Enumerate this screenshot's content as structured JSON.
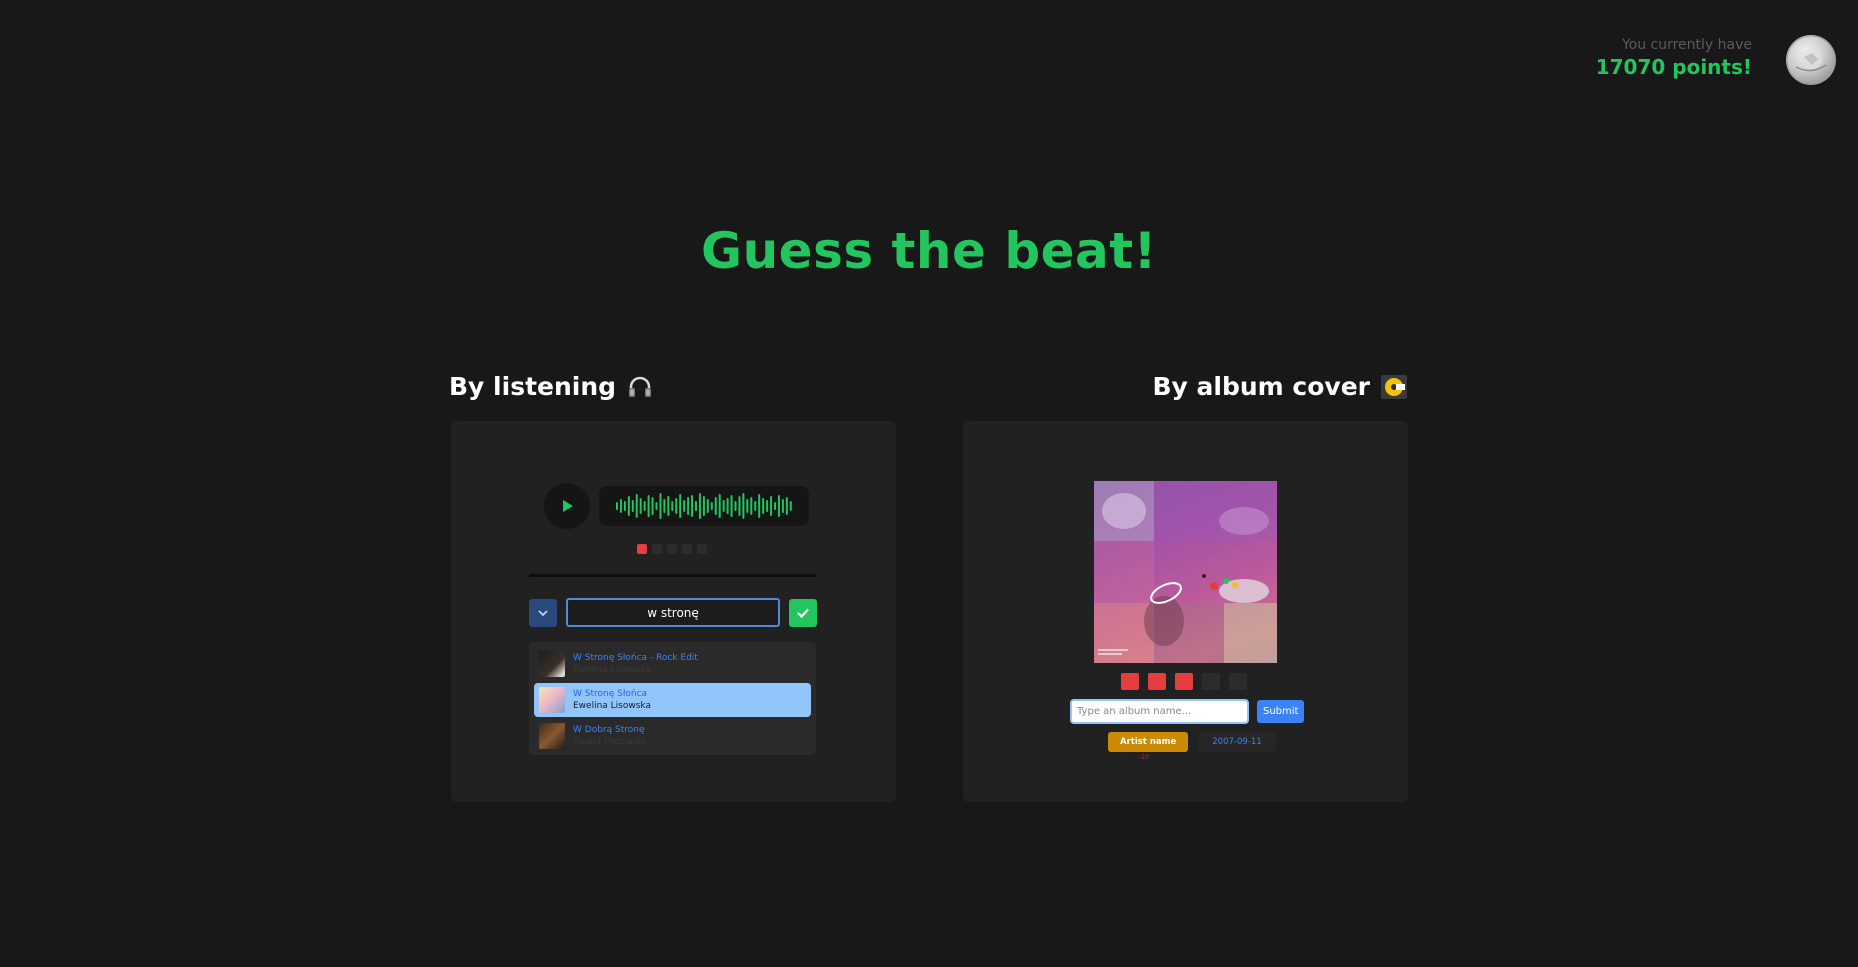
{
  "header": {
    "points_label": "You currently have",
    "points_value": "17070 points!"
  },
  "title": "Guess the beat!",
  "listening": {
    "heading": "By listening",
    "heading_icon": "headphones-icon",
    "progress": {
      "total_tries": 5,
      "current": 1
    },
    "guess_value": "w stronę",
    "suggestions": [
      {
        "title": "W Stronę Słońca - Rock Edit",
        "artist": "Ewelina Lisowska",
        "selected": false
      },
      {
        "title": "W Stronę Słońca",
        "artist": "Ewelina Lisowska",
        "selected": true
      },
      {
        "title": "W Dobrą Stronę",
        "artist": "Dawid Podsiadło",
        "selected": false
      }
    ]
  },
  "album": {
    "heading": "By album cover",
    "heading_icon": "album-cover-icon",
    "tries": {
      "total": 5,
      "used": 3
    },
    "input_placeholder": "Type an album name...",
    "submit_label": "Submit",
    "hint_button": "Artist name",
    "hint_date": "2007-09-11",
    "hint_note": "-10"
  },
  "colors": {
    "accent": "#22c55e",
    "background": "#181818",
    "card": "#212121",
    "error": "#e53e3e",
    "link": "#3b82f6"
  }
}
